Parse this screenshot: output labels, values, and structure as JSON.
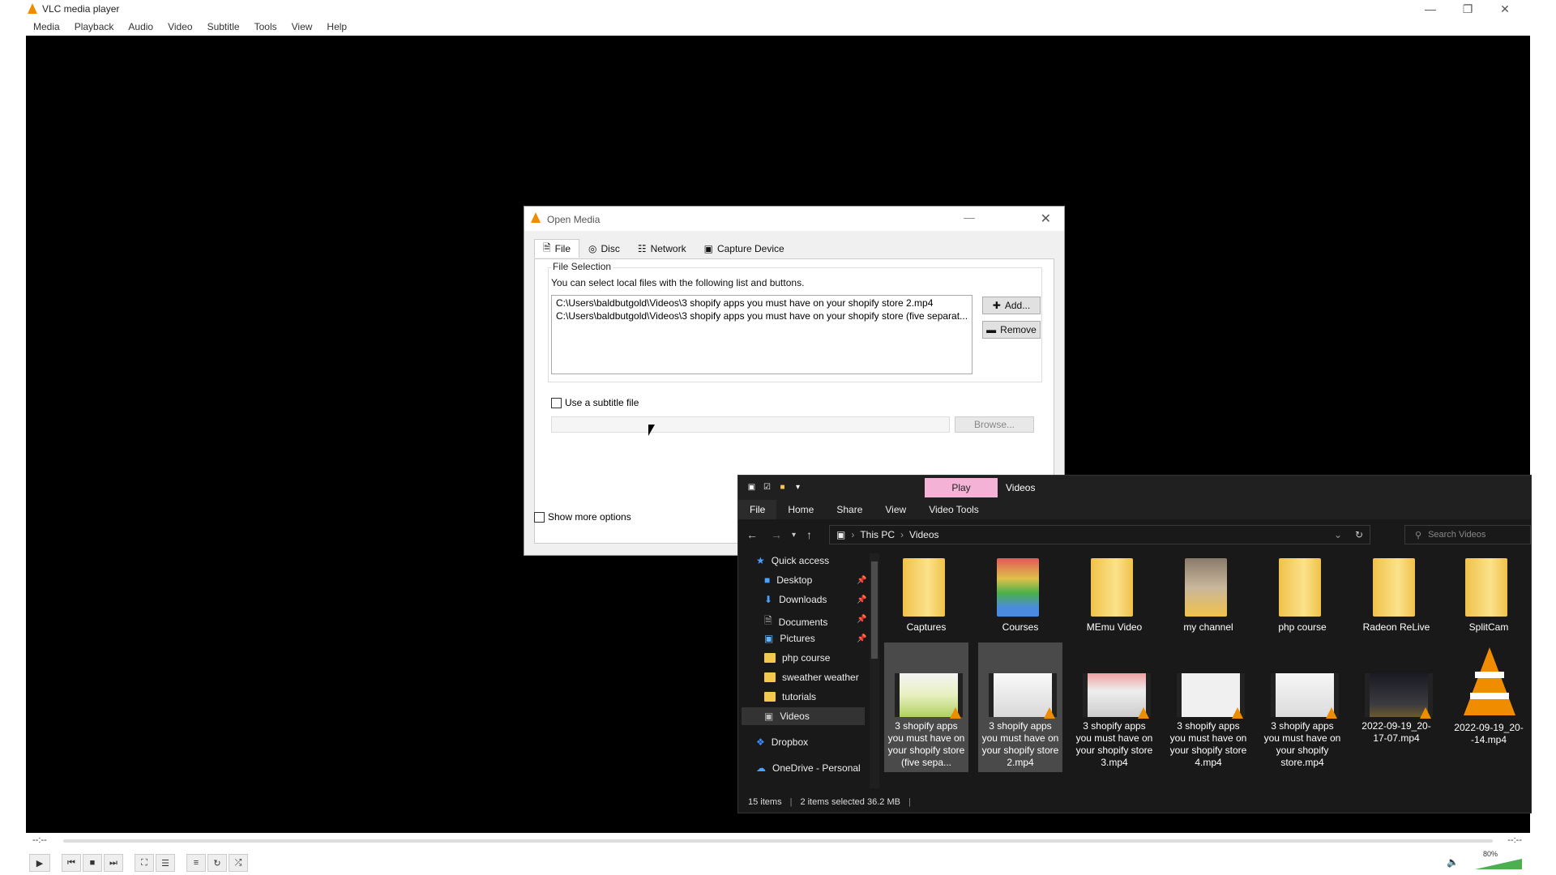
{
  "vlc": {
    "title": "VLC media player",
    "menu": [
      "Media",
      "Playback",
      "Audio",
      "Video",
      "Subtitle",
      "Tools",
      "View",
      "Help"
    ],
    "time_left": "--:--",
    "time_right": "--:--",
    "volume": "80%",
    "volume_level": 0.8
  },
  "dialog": {
    "title": "Open Media",
    "tabs": [
      "File",
      "Disc",
      "Network",
      "Capture Device"
    ],
    "file_selection_label": "File Selection",
    "file_selection_desc": "You can select local files with the following list and buttons.",
    "files": [
      "C:\\Users\\baldbutgold\\Videos\\3 shopify apps you must have on your shopify store 2.mp4",
      "C:\\Users\\baldbutgold\\Videos\\3 shopify apps you must have on your shopify store (five separat..."
    ],
    "add_label": "Add...",
    "remove_label": "Remove",
    "subtitle_label": "Use a subtitle file",
    "browse_label": "Browse...",
    "more_options_label": "Show more options"
  },
  "explorer": {
    "play_tab": "Play",
    "title": "Videos",
    "ribbon": [
      "File",
      "Home",
      "Share",
      "View",
      "Video Tools"
    ],
    "breadcrumb": [
      "This PC",
      "Videos"
    ],
    "search_placeholder": "Search Videos",
    "nav": {
      "quick_access": "Quick access",
      "desktop": "Desktop",
      "downloads": "Downloads",
      "documents": "Documents",
      "pictures": "Pictures",
      "php_course": "php course",
      "sweather": "sweather weather",
      "tutorials": "tutorials",
      "videos": "Videos",
      "dropbox": "Dropbox",
      "onedrive": "OneDrive - Personal"
    },
    "folders": [
      "Captures",
      "Courses",
      "MEmu Video",
      "my channel",
      "php course",
      "Radeon ReLive",
      "SplitCam"
    ],
    "videos": [
      "3 shopify apps you must have on your shopify store (five sepa...",
      "3 shopify apps you must have on your shopify store 2.mp4",
      "3 shopify apps you must have on your shopify store 3.mp4",
      "3 shopify apps you must have on your shopify store 4.mp4",
      "3 shopify apps you must have on your shopify store.mp4",
      "2022-09-19_20-17-07.mp4",
      "2022-09-19_20--14.mp4"
    ],
    "status_items": "15 items",
    "status_selected": "2 items selected  36.2 MB"
  }
}
